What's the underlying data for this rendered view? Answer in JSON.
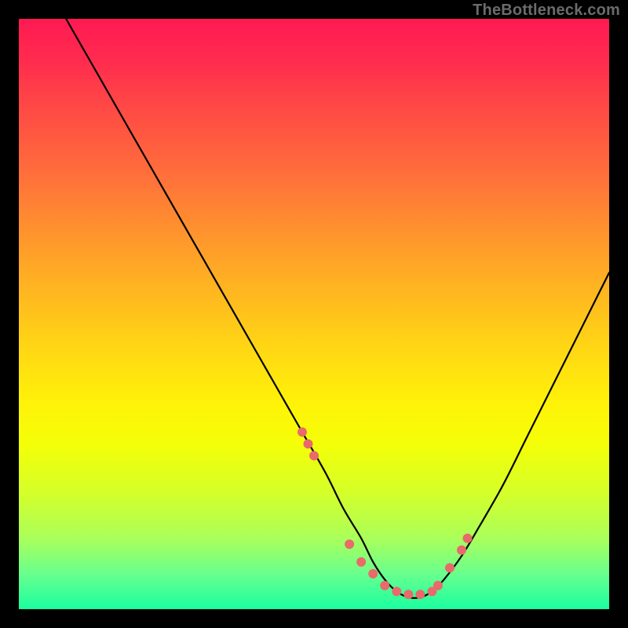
{
  "watermark": "TheBottleneck.com",
  "chart_data": {
    "type": "line",
    "title": "",
    "xlabel": "",
    "ylabel": "",
    "xlim": [
      0,
      100
    ],
    "ylim": [
      0,
      100
    ],
    "grid": false,
    "legend": false,
    "curve": {
      "name": "bottleneck-curve",
      "color": "#000000",
      "x": [
        8,
        12,
        16,
        20,
        24,
        28,
        32,
        36,
        40,
        44,
        48,
        52,
        55,
        58,
        60,
        62,
        64,
        66,
        68,
        70,
        72,
        75,
        78,
        82,
        86,
        90,
        94,
        97,
        100
      ],
      "y": [
        100,
        93,
        86,
        79,
        72,
        65,
        58,
        51,
        44,
        37,
        30,
        23,
        17,
        12,
        8,
        5,
        3,
        2,
        2,
        3,
        5,
        9,
        14,
        21,
        29,
        37,
        45,
        51,
        57
      ]
    },
    "dotted_overlay": {
      "name": "highlight-dots",
      "color": "#e86a6a",
      "radius_px": 6,
      "x": [
        48,
        49,
        50,
        56,
        58,
        60,
        62,
        64,
        66,
        68,
        70,
        71,
        73,
        75,
        76
      ],
      "y": [
        30,
        28,
        26,
        11,
        8,
        6,
        4,
        3,
        2.5,
        2.5,
        3,
        4,
        7,
        10,
        12
      ]
    },
    "gradient_stops": [
      {
        "pct": 0,
        "color": "#ff1a52"
      },
      {
        "pct": 65,
        "color": "#fff208"
      },
      {
        "pct": 100,
        "color": "#1aff9f"
      }
    ]
  }
}
